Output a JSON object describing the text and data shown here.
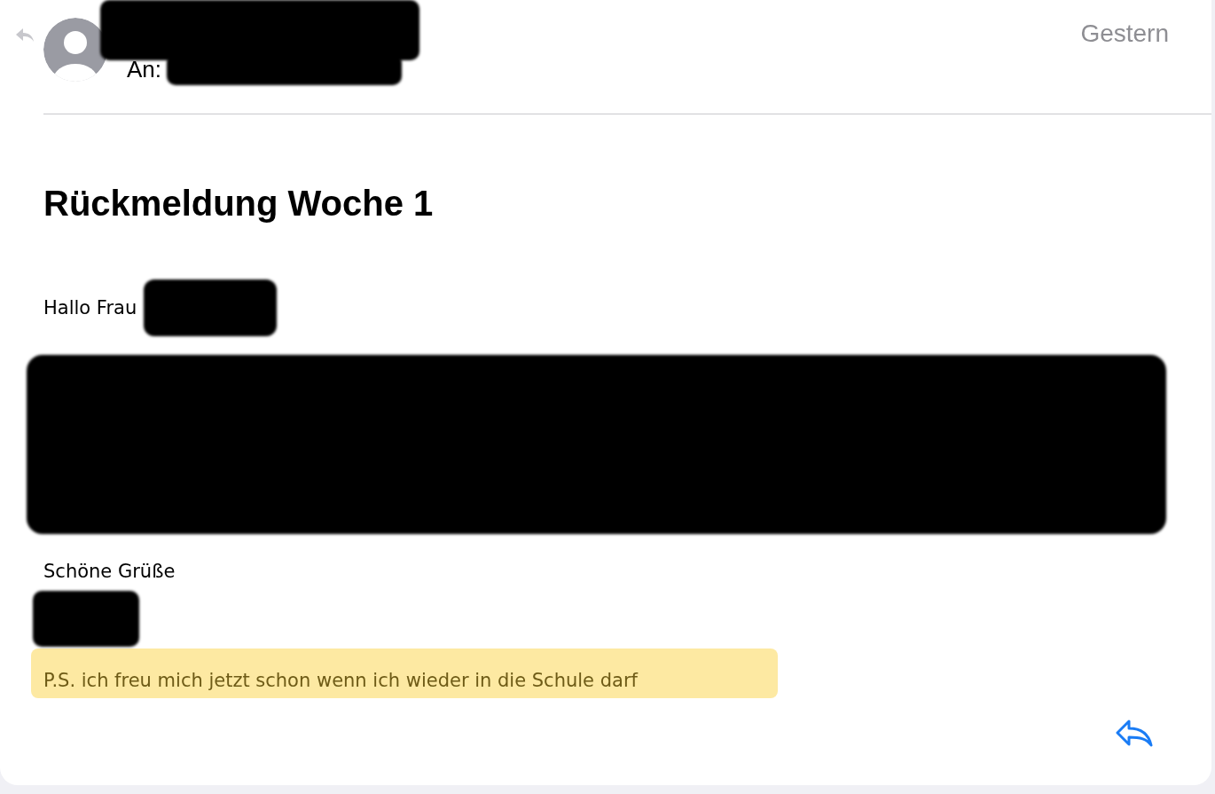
{
  "header": {
    "to_label": "An:",
    "date": "Gestern"
  },
  "subject": "Rückmeldung Woche 1",
  "body": {
    "greeting": "Hallo Frau",
    "closing": "Schöne Grüße",
    "postscript": {
      "text": "P.S. ich freu mich jetzt schon wenn ich wieder in die Schule darf",
      "highlighted": true
    }
  }
}
